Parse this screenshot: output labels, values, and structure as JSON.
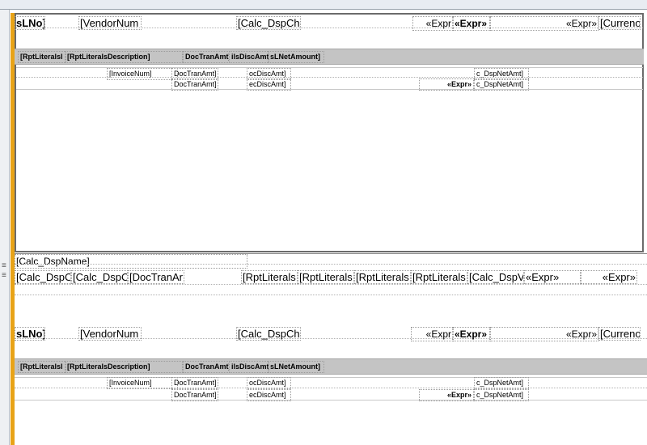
{
  "group1": {
    "header": {
      "sl_no": "sLNo]",
      "vendor_num": "[VendorNum",
      "calc_dsp_ch": "[Calc_DspCh",
      "expr_a": "«Expr",
      "expr_b": "«Expr»",
      "expr_c": "«Expr»",
      "currency": "[Curreno"
    },
    "column_band": {
      "rpt_literals": "[RptLiteralsI",
      "rpt_literals_description": "[RptLiteralsDescription]",
      "doc_tran_amt": "DocTranAmt]",
      "disc_amt": "ilsDiscAmt]",
      "net_amount": "sLNetAmount]"
    },
    "detail_row1": {
      "invoice_num": "[InvoiceNum]",
      "doc_tran_amt": "DocTranAmt]",
      "disc_amt": "ocDiscAmt]",
      "dsp_net_amt": "c_DspNetAmt]"
    },
    "detail_row2": {
      "doc_tran_amt": "DocTranAmt]",
      "disc_amt": "ecDiscAmt]",
      "expr": "«Expr»",
      "dsp_net_amt": "c_DspNetAmt]"
    }
  },
  "middle": {
    "calc_dsp_name": "[Calc_DspName]",
    "totals": {
      "calc_dsp_1": "[Calc_DspC",
      "calc_dsp_2": "[Calc_DspC",
      "doc_tran": "[DocTranAr",
      "rpt_literals_1": "[RptLiterals",
      "rpt_literals_2": "[RptLiterals",
      "rpt_literals_3": "[RptLiterals",
      "rpt_literals_4": "[RptLiterals",
      "calc_dsp_3": "[Calc_DspV",
      "expr_1": "«Expr»",
      "expr_2": "«Expr»"
    }
  },
  "group2": {
    "header": {
      "sl_no": "sLNo]",
      "vendor_num": "[VendorNum",
      "calc_dsp_ch": "[Calc_DspCh",
      "expr_a": "«Expr",
      "expr_b": "«Expr»",
      "expr_c": "«Expr»",
      "currency": "[Curreno"
    },
    "column_band": {
      "rpt_literals": "[RptLiteralsI",
      "rpt_literals_description": "[RptLiteralsDescription]",
      "doc_tran_amt": "DocTranAmt]",
      "disc_amt": "ilsDiscAmt]",
      "net_amount": "sLNetAmount]"
    },
    "detail_row1": {
      "invoice_num": "[InvoiceNum]",
      "doc_tran_amt": "DocTranAmt]",
      "disc_amt": "ocDiscAmt]",
      "dsp_net_amt": "c_DspNetAmt]"
    },
    "detail_row2": {
      "doc_tran_amt": "DocTranAmt]",
      "disc_amt": "ecDiscAmt]",
      "expr": "«Expr»",
      "dsp_net_amt": "c_DspNetAmt]"
    }
  },
  "icons": {
    "gutter_grip": "grip-lines-icon"
  },
  "colors": {
    "accent_bar": "#e8a317",
    "band_fill": "#c4c4c4",
    "section_border": "#6b6b6b"
  }
}
